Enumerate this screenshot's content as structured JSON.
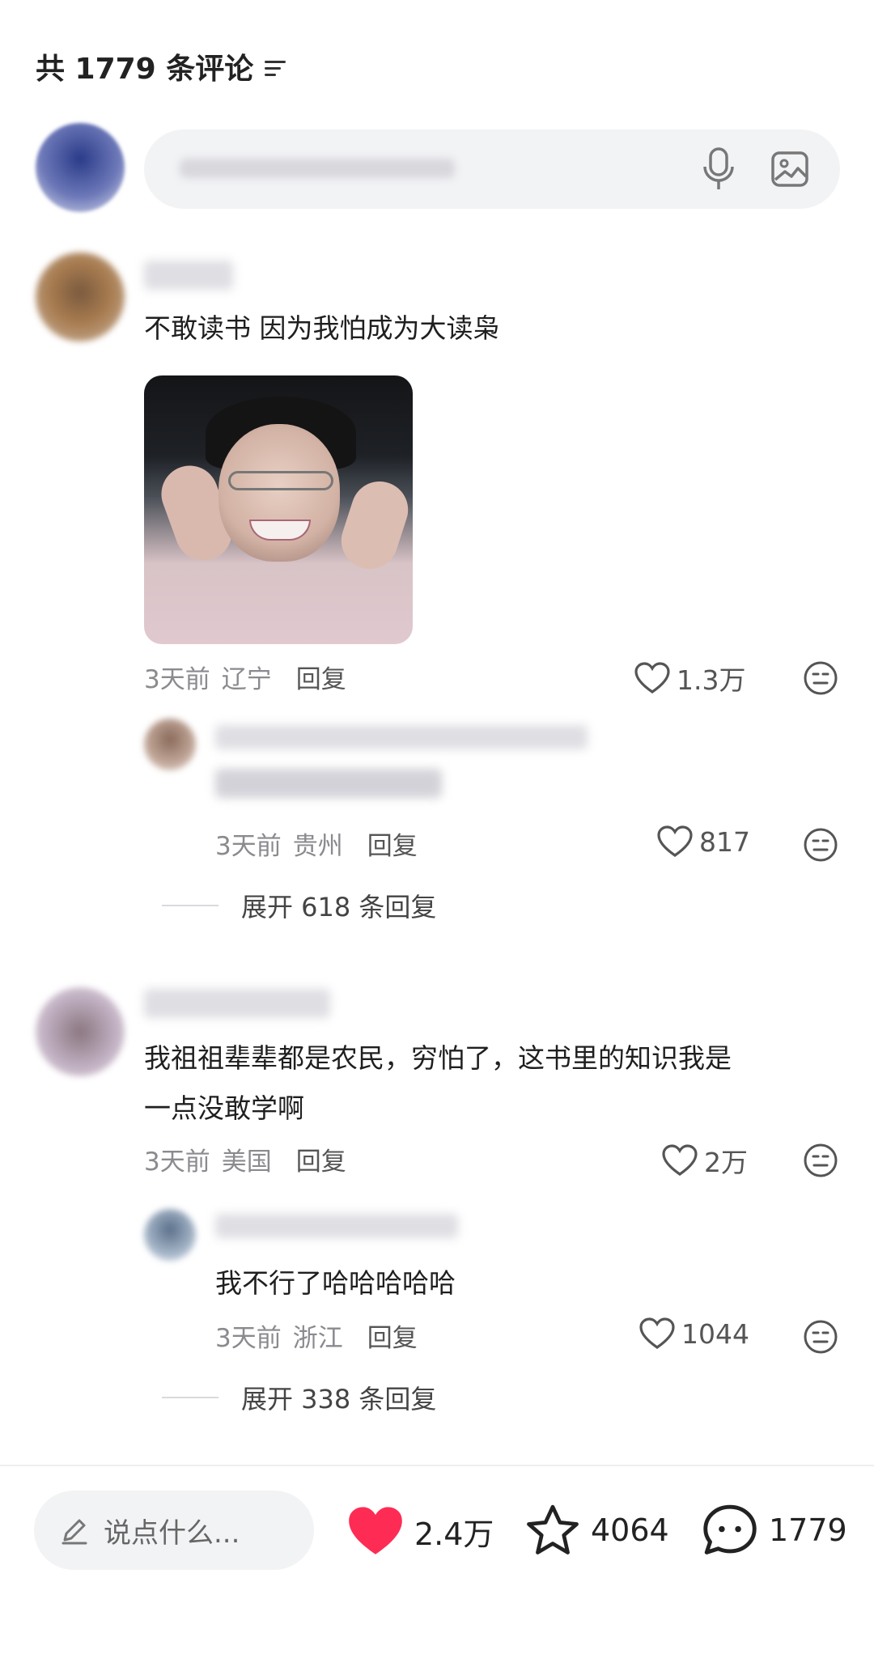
{
  "header": {
    "count_label": "共 1779 条评论"
  },
  "comments": [
    {
      "text": "不敢读书 因为我怕成为大读枭",
      "time": "3天前",
      "location": "辽宁",
      "reply_label": "回复",
      "likes": "1.3万",
      "reply": {
        "time": "3天前",
        "location": "贵州",
        "reply_label": "回复",
        "likes": "817"
      },
      "expand_label": "展开 618 条回复"
    },
    {
      "text_line1": "我祖祖辈辈都是农民，穷怕了，这书里的知识我是",
      "text_line2": "一点没敢学啊",
      "time": "3天前",
      "location": "美国",
      "reply_label": "回复",
      "likes": "2万",
      "reply": {
        "text": "我不行了哈哈哈哈哈",
        "time": "3天前",
        "location": "浙江",
        "reply_label": "回复",
        "likes": "1044"
      },
      "expand_label": "展开 338 条回复"
    }
  ],
  "bottom_bar": {
    "input_placeholder": "说点什么...",
    "like_count": "2.4万",
    "fav_count": "4064",
    "comment_count": "1779",
    "like_color": "#fe2c55"
  },
  "icons": [
    "sort-icon",
    "mic-icon",
    "image-icon",
    "heart-outline-icon",
    "emoji-icon",
    "pencil-icon",
    "heart-filled-icon",
    "star-icon",
    "chat-bubble-icon"
  ]
}
